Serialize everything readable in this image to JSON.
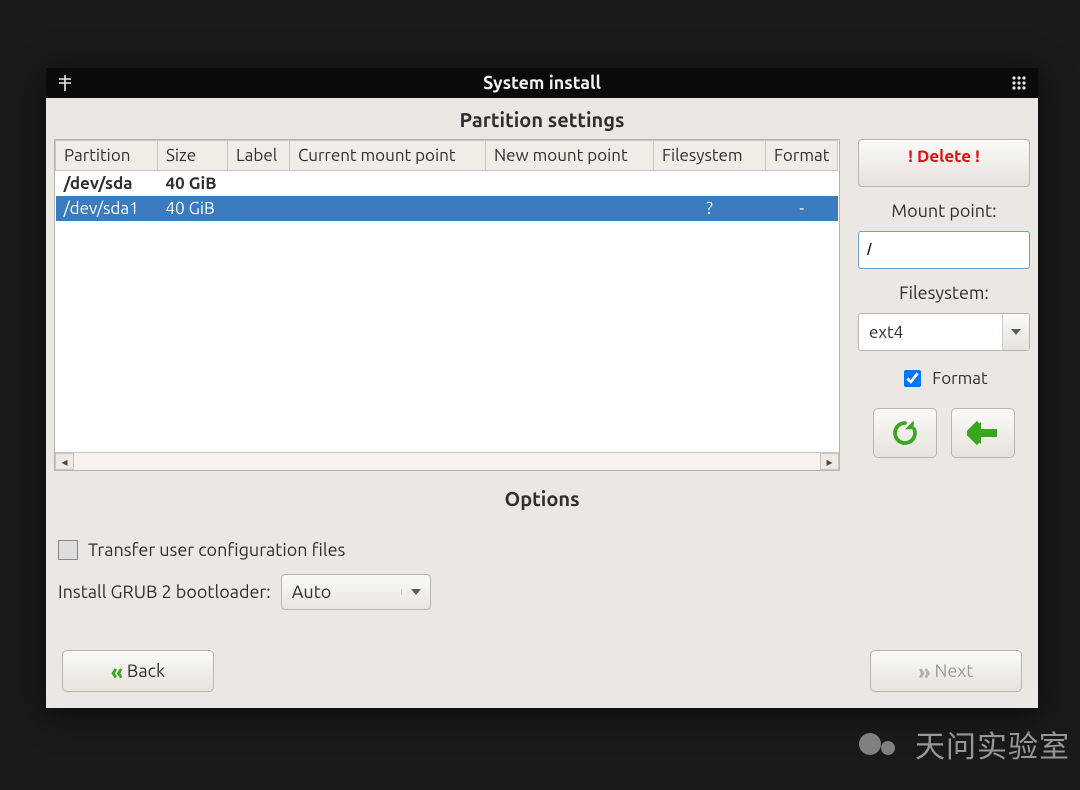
{
  "window": {
    "title": "System install"
  },
  "partition": {
    "heading": "Partition settings",
    "columns": [
      "Partition",
      "Size",
      "Label",
      "Current mount point",
      "New mount point",
      "Filesystem",
      "Format"
    ],
    "rows": [
      {
        "partition": "/dev/sda",
        "size": "40 GiB",
        "label": "",
        "cur_mount": "",
        "new_mount": "",
        "fs": "",
        "format": "",
        "bold": true,
        "selected": false
      },
      {
        "partition": "/dev/sda1",
        "size": "40 GiB",
        "label": "",
        "cur_mount": "",
        "new_mount": "",
        "fs": "?",
        "format": "-",
        "bold": false,
        "selected": true
      }
    ]
  },
  "sidebar": {
    "delete_label": "! Delete !",
    "mount_point_label": "Mount point:",
    "mount_point_value": "/",
    "filesystem_label": "Filesystem:",
    "filesystem_value": "ext4",
    "format_label": "Format",
    "format_checked": true
  },
  "options": {
    "heading": "Options",
    "transfer_label": "Transfer user configuration files",
    "transfer_checked": false,
    "bootloader_label": "Install GRUB 2 bootloader:",
    "bootloader_value": "Auto"
  },
  "nav": {
    "back_label": "Back",
    "next_label": "Next",
    "next_enabled": false
  },
  "watermark": {
    "text": "天问实验室"
  }
}
